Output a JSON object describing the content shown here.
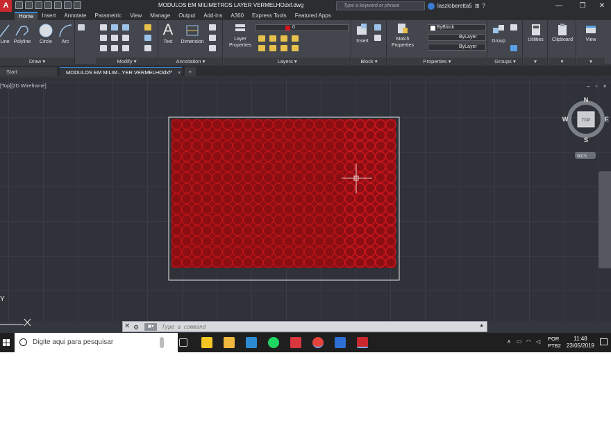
{
  "window": {
    "title": "MODULOS EM MILIMETROS LAYER VERMELHOdxf.dwg",
    "app_logo": "A",
    "search_placeholder": "Type a keyword or phrase",
    "user_name": "laszloberetta5",
    "min": "—",
    "max": "❐",
    "close": "✕"
  },
  "ribbon_tabs": [
    "Home",
    "Insert",
    "Annotate",
    "Parametric",
    "View",
    "Manage",
    "Output",
    "Add-ins",
    "A360",
    "Express Tools",
    "Featured Apps"
  ],
  "ribbon": {
    "draw": {
      "label": "Draw ▾",
      "tools": [
        "Line",
        "Polyline",
        "Circle",
        "Arc"
      ]
    },
    "modify": {
      "label": "Modify ▾"
    },
    "annotation": {
      "label": "Annotation ▾",
      "tools": [
        "Text",
        "Dimension"
      ]
    },
    "layers": {
      "label": "Layers ▾",
      "tool": "Layer Properties",
      "current_layer": "0"
    },
    "block": {
      "label": "Block ▾",
      "tool": "Insert"
    },
    "properties": {
      "label": "Properties ▾",
      "tool": "Match Properties",
      "color": "ByBlock",
      "linetype": "ByLayer",
      "lineweight": "ByLayer"
    },
    "groups": {
      "label": "Groups ▾",
      "tool": "Group"
    },
    "utilities": {
      "label": "Utilities"
    },
    "clipboard": {
      "label": "Clipboard"
    },
    "view": {
      "label": "View"
    }
  },
  "file_tabs": {
    "start": "Start",
    "drawing": "MODULOS EM MILIM...YER VERMELHOdxf*",
    "close": "×",
    "new": "+"
  },
  "viewport": {
    "label": "[Top][2D Wireframe]",
    "controls": "– ▫ ×",
    "viewcube": {
      "n": "N",
      "s": "S",
      "e": "E",
      "w": "W",
      "top": "TOP",
      "wcs": "WCS"
    },
    "ucs_y": "Y"
  },
  "drawing": {
    "columns": 22,
    "rows": 14,
    "dense_columns_from": 17,
    "circle_color": "#c8161d",
    "fill_color": "#8b0e12",
    "border_color": "#e8e8e8"
  },
  "command_line": {
    "placeholder": "Type a command",
    "prompt_icon": "▣▾"
  },
  "taskbar": {
    "search_text": "Digite aqui para pesquisar",
    "language_top": "POR",
    "language_bottom": "PTB2",
    "time": "11:48",
    "date": "23/05/2019"
  }
}
